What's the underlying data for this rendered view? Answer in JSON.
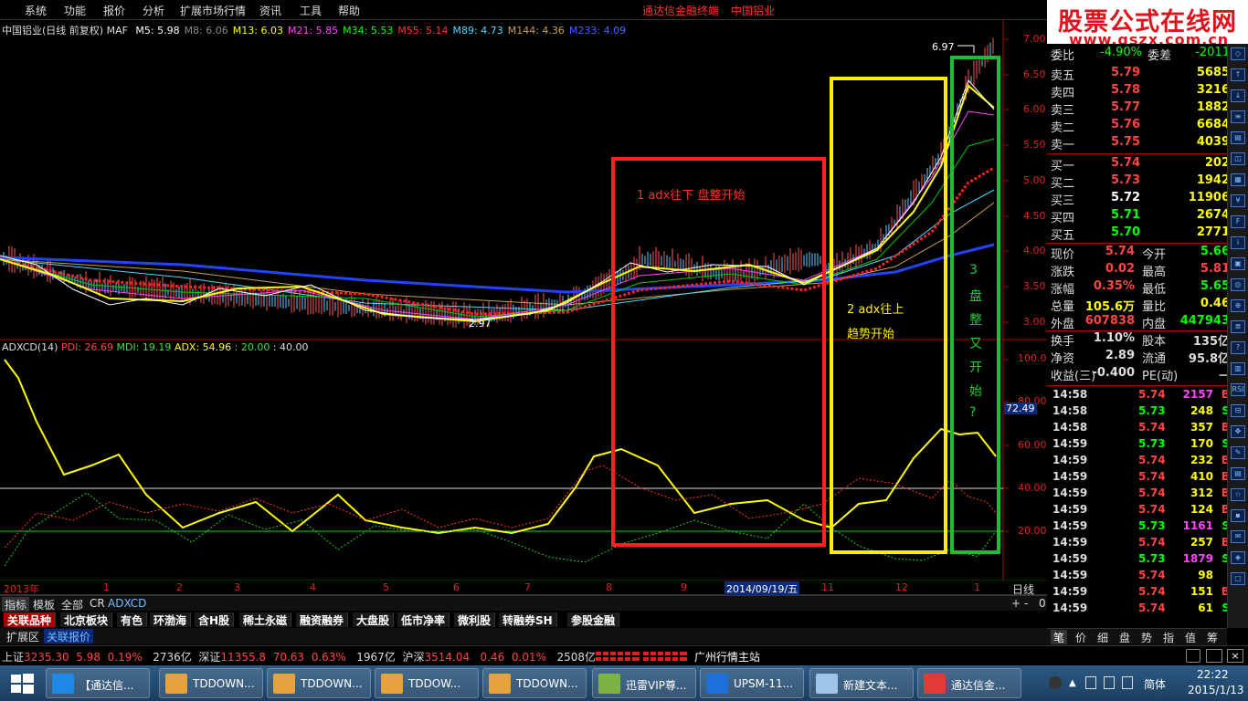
{
  "menu": {
    "items": [
      "系统",
      "功能",
      "报价",
      "分析",
      "扩展市场行情",
      "资讯",
      "工具",
      "帮助"
    ],
    "title_app": "通达信金融终端",
    "title_stock": "中国铝业"
  },
  "watermark": {
    "line1": "股票公式在线网",
    "line2": "www.gszx.com.cn"
  },
  "main_chart": {
    "header": "中国铝业(日线 前复权) MAF",
    "ma": [
      {
        "label": "M5: 5.98",
        "color": "#ffffff"
      },
      {
        "label": "M8: 6.06",
        "color": "#888888"
      },
      {
        "label": "M13: 6.03",
        "color": "#ffff00"
      },
      {
        "label": "M21: 5.85",
        "color": "#ff44ff"
      },
      {
        "label": "M34: 5.53",
        "color": "#00ff00"
      },
      {
        "label": "M55: 5.14",
        "color": "#ff3333"
      },
      {
        "label": "M89: 4.73",
        "color": "#44ddff"
      },
      {
        "label": "M144: 4.36",
        "color": "#c8a050"
      },
      {
        "label": "M233: 4.09",
        "color": "#4466ff"
      }
    ],
    "y_ticks": [
      "7.00",
      "6.50",
      "6.00",
      "5.50",
      "5.00",
      "4.50",
      "4.00",
      "3.50",
      "3.00"
    ],
    "high_label": "6.97",
    "low_label": "2.97"
  },
  "indicator": {
    "header": "ADXCD(14)",
    "pdi": "PDI: 26.69",
    "mdi": "MDI: 19.19",
    "adx": "ADX: 54.96",
    "l20": ": 20.00",
    "l40": ": 40.00",
    "y_ticks": [
      "100.0",
      "80.00",
      "60.00",
      "40.00",
      "20.00"
    ],
    "cursor_value": "72.49"
  },
  "annotations": {
    "red": "1 adx往下 盘整开始",
    "yellow_1": "2 adx往上",
    "yellow_2": "趋势开始",
    "green": [
      "3",
      "盘",
      "整",
      "又",
      "开",
      "始",
      "?"
    ]
  },
  "x_axis": {
    "labels": [
      "2013年",
      "1",
      "2",
      "3",
      "4",
      "5",
      "6",
      "7",
      "8",
      "9",
      "2014/09/19/五",
      "11",
      "12",
      "1"
    ],
    "period": "日线"
  },
  "quote": {
    "top": {
      "label": "委比",
      "pct": "-4.90%",
      "label2": "委差",
      "val": "-2011"
    },
    "asks": [
      {
        "name": "卖五",
        "price": "5.79",
        "vol": "5685"
      },
      {
        "name": "卖四",
        "price": "5.78",
        "vol": "3216"
      },
      {
        "name": "卖三",
        "price": "5.77",
        "vol": "1882"
      },
      {
        "name": "卖二",
        "price": "5.76",
        "vol": "6684"
      },
      {
        "name": "卖一",
        "price": "5.75",
        "vol": "4039"
      }
    ],
    "bids": [
      {
        "name": "买一",
        "price": "5.74",
        "vol": "202"
      },
      {
        "name": "买二",
        "price": "5.73",
        "vol": "1942"
      },
      {
        "name": "买三",
        "price": "5.72",
        "vol": "11906"
      },
      {
        "name": "买四",
        "price": "5.71",
        "vol": "2674"
      },
      {
        "name": "买五",
        "price": "5.70",
        "vol": "2771"
      }
    ],
    "stats": [
      {
        "k1": "现价",
        "v1": "5.74",
        "c1": "#ff4444",
        "k2": "今开",
        "v2": "5.66",
        "c2": "#00ff00"
      },
      {
        "k1": "涨跌",
        "v1": "0.02",
        "c1": "#ff4444",
        "k2": "最高",
        "v2": "5.81",
        "c2": "#ff4444"
      },
      {
        "k1": "涨幅",
        "v1": "0.35%",
        "c1": "#ff4444",
        "k2": "最低",
        "v2": "5.65",
        "c2": "#00ff00"
      },
      {
        "k1": "总量",
        "v1": "105.6万",
        "c1": "#ffff00",
        "k2": "量比",
        "v2": "0.46",
        "c2": "#ffff00"
      },
      {
        "k1": "外盘",
        "v1": "607838",
        "c1": "#ff4444",
        "k2": "内盘",
        "v2": "447943",
        "c2": "#00ff00"
      },
      {
        "k1": "换手",
        "v1": "1.10%",
        "c1": "#dddddd",
        "k2": "股本",
        "v2": "135亿",
        "c2": "#dddddd"
      },
      {
        "k1": "净资",
        "v1": "2.89",
        "c1": "#dddddd",
        "k2": "流通",
        "v2": "95.8亿",
        "c2": "#dddddd"
      },
      {
        "k1": "收益(三)",
        "v1": "-0.400",
        "c1": "#dddddd",
        "k2": "PE(动)",
        "v2": "－",
        "c2": "#dddddd"
      }
    ]
  },
  "ticks": [
    {
      "t": "14:58",
      "p": "5.74",
      "v": "2157",
      "s": "B"
    },
    {
      "t": "14:58",
      "p": "5.73",
      "v": "248",
      "s": "S"
    },
    {
      "t": "14:58",
      "p": "5.74",
      "v": "357",
      "s": "B"
    },
    {
      "t": "14:59",
      "p": "5.73",
      "v": "170",
      "s": "S"
    },
    {
      "t": "14:59",
      "p": "5.74",
      "v": "232",
      "s": "B"
    },
    {
      "t": "14:59",
      "p": "5.74",
      "v": "410",
      "s": "B"
    },
    {
      "t": "14:59",
      "p": "5.74",
      "v": "312",
      "s": "B"
    },
    {
      "t": "14:59",
      "p": "5.74",
      "v": "124",
      "s": "B"
    },
    {
      "t": "14:59",
      "p": "5.73",
      "v": "1161",
      "s": "S"
    },
    {
      "t": "14:59",
      "p": "5.74",
      "v": "257",
      "s": "B"
    },
    {
      "t": "14:59",
      "p": "5.73",
      "v": "1879",
      "s": "S"
    },
    {
      "t": "14:59",
      "p": "5.74",
      "v": "98",
      "s": ""
    },
    {
      "t": "14:59",
      "p": "5.74",
      "v": "151",
      "s": "B"
    },
    {
      "t": "14:59",
      "p": "5.74",
      "v": "61",
      "s": "S"
    }
  ],
  "bottom_tabs": {
    "row1": [
      "指标",
      "模板",
      "全部",
      "CR",
      "ADXCD"
    ],
    "row1_right": [
      "+",
      "-",
      "0"
    ]
  },
  "sector_tabs": [
    "关联品种",
    "北京板块",
    "有色",
    "环渤海",
    "含H股",
    "稀土永磁",
    "融资融券",
    "大盘股",
    "低市净率",
    "微利股",
    "转融券SH",
    "参股金融"
  ],
  "tab_row3": [
    "扩展区",
    "关联报价"
  ],
  "right_tabs": [
    "笔",
    "价",
    "细",
    "盘",
    "势",
    "指",
    "值",
    "筹"
  ],
  "status": {
    "sh_label": "上证",
    "sh_val": "3235.30",
    "sh_chg": "5.98",
    "sh_pct": "0.19%",
    "sh_amt": "2736亿",
    "sz_label": "深证",
    "sz_val": "11355.8",
    "sz_chg": "70.63",
    "sz_pct": "0.63%",
    "sz_amt": "1967亿",
    "hs_label": "沪深",
    "hs_val": "3514.04",
    "hs_chg": "0.46",
    "hs_pct": "0.01%",
    "hs_amt": "2508亿",
    "server": "广州行情主站"
  },
  "taskbar": {
    "items": [
      "【通达信...",
      "TDDOWN...",
      "TDDOWN...",
      "TDDOW...",
      "TDDOWN...",
      "迅雷VIP尊...",
      "UPSM-11...",
      "新建文本...",
      "通达信金..."
    ],
    "ime": "简体",
    "time": "22:22",
    "date": "2015/1/13"
  }
}
